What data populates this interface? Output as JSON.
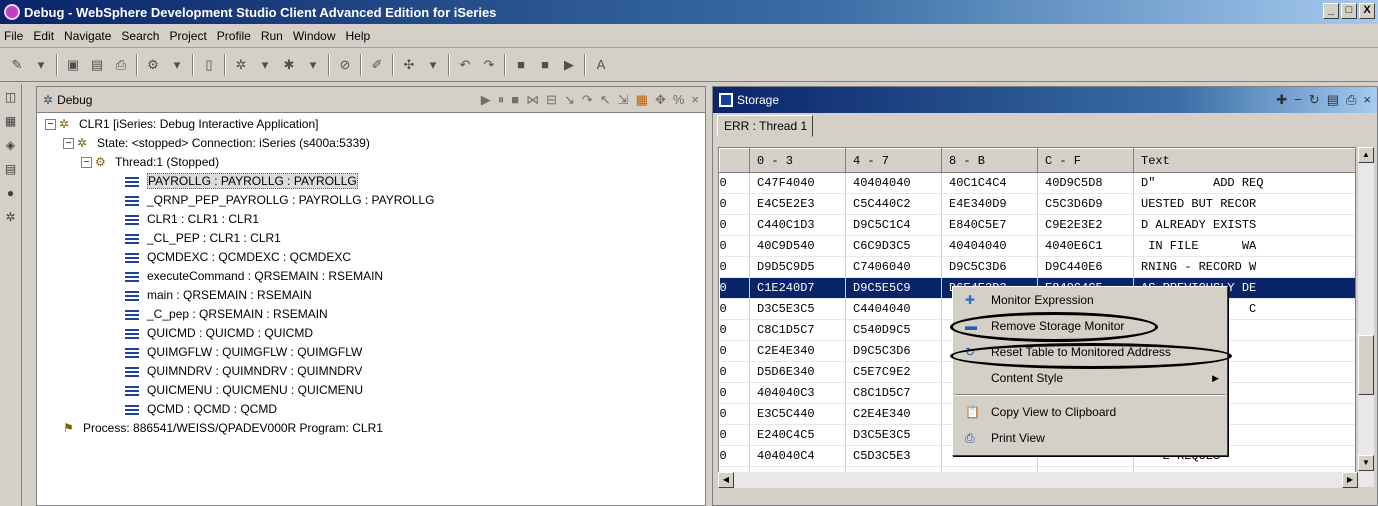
{
  "window": {
    "title": "Debug - WebSphere Development Studio Client Advanced Edition for iSeries",
    "buttons": [
      "_",
      "□",
      "X"
    ]
  },
  "menu": [
    "File",
    "Edit",
    "Navigate",
    "Search",
    "Project",
    "Profile",
    "Run",
    "Window",
    "Help"
  ],
  "debug_view": {
    "title": "Debug",
    "tree": [
      {
        "level": 0,
        "label": "CLR1 [iSeries: Debug Interactive Application]",
        "icon": "debug-target-icon",
        "toggle": "−"
      },
      {
        "level": 1,
        "label": "State: <stopped> Connection: iSeries (s400a:5339)",
        "icon": "state-icon",
        "toggle": "−"
      },
      {
        "level": 2,
        "label": "Thread:1 (Stopped)",
        "icon": "thread-icon",
        "toggle": "−"
      },
      {
        "level": 3,
        "label": "PAYROLLG : PAYROLLG : PAYROLLG",
        "icon": "stack-frame-icon",
        "selected": true
      },
      {
        "level": 3,
        "label": "_QRNP_PEP_PAYROLLG : PAYROLLG : PAYROLLG",
        "icon": "stack-frame-icon"
      },
      {
        "level": 3,
        "label": "CLR1 : CLR1 : CLR1",
        "icon": "stack-frame-icon"
      },
      {
        "level": 3,
        "label": "_CL_PEP : CLR1 : CLR1",
        "icon": "stack-frame-icon"
      },
      {
        "level": 3,
        "label": "QCMDEXC : QCMDEXC : QCMDEXC",
        "icon": "stack-frame-icon"
      },
      {
        "level": 3,
        "label": "executeCommand : QRSEMAIN : RSEMAIN",
        "icon": "stack-frame-icon"
      },
      {
        "level": 3,
        "label": "main : QRSEMAIN : RSEMAIN",
        "icon": "stack-frame-icon"
      },
      {
        "level": 3,
        "label": "_C_pep : QRSEMAIN : RSEMAIN",
        "icon": "stack-frame-icon"
      },
      {
        "level": 3,
        "label": "QUICMD : QUICMD : QUICMD",
        "icon": "stack-frame-icon"
      },
      {
        "level": 3,
        "label": "QUIMGFLW : QUIMGFLW : QUIMGFLW",
        "icon": "stack-frame-icon"
      },
      {
        "level": 3,
        "label": "QUIMNDRV : QUIMNDRV : QUIMNDRV",
        "icon": "stack-frame-icon"
      },
      {
        "level": 3,
        "label": "QUICMENU : QUICMENU : QUICMENU",
        "icon": "stack-frame-icon"
      },
      {
        "level": 3,
        "label": "QCMD : QCMD : QCMD",
        "icon": "stack-frame-icon"
      },
      {
        "level": 1,
        "label": "Process: 886541/WEISS/QPADEV000R  Program: CLR1",
        "icon": "process-icon"
      }
    ]
  },
  "storage_view": {
    "title": "Storage",
    "tab": "ERR : Thread 1",
    "columns": [
      "",
      "0 - 3",
      "4 - 7",
      "8 - B",
      "C - F",
      "Text"
    ],
    "rows": [
      [
        "0",
        "C47F4040",
        "40404040",
        "40C1C4C4",
        "40D9C5D8",
        "D\"        ADD REQ"
      ],
      [
        "0",
        "E4C5E2E3",
        "C5C440C2",
        "E4E340D9",
        "C5C3D6D9",
        "UESTED BUT RECOR"
      ],
      [
        "0",
        "C440C1D3",
        "D9C5C1C4",
        "E840C5E7",
        "C9E2E3E2",
        "D ALREADY EXISTS"
      ],
      [
        "0",
        "40C9D540",
        "C6C9D3C5",
        "40404040",
        "4040E6C1",
        " IN FILE      WA"
      ],
      [
        "0",
        "D9D5C9D5",
        "C7406040",
        "D9C5C3D6",
        "D9C440E6",
        "RNING - RECORD W"
      ],
      [
        "0",
        "C1E240D7",
        "D9C5E5C9",
        "D6E4E2D3",
        "E840C4C5",
        "AS PREVIOUSLY DE"
      ],
      [
        "0",
        "D3C5E3C5",
        "C4404040",
        "",
        "",
        "               C"
      ],
      [
        "0",
        "C8C1D5C7",
        "C540D9C5",
        "",
        "",
        "   QUESTED"
      ],
      [
        "0",
        "C2E4E340",
        "D9C5C3D6",
        "",
        "",
        "   RD DOES"
      ],
      [
        "0",
        "D5D6E340",
        "C5E7C9E2",
        "",
        "",
        "   T"
      ],
      [
        "0",
        "404040C3",
        "C8C1D5C7",
        "",
        "",
        "   E REQUES"
      ],
      [
        "0",
        "E3C5C440",
        "C2E4E340",
        "",
        "",
        "   RECORD I"
      ],
      [
        "0",
        "E240C4C5",
        "D3C5E3C5",
        "",
        "",
        "   D"
      ],
      [
        "0",
        "404040C4",
        "C5D3C5E3",
        "",
        "",
        "   E REQUES"
      ],
      [
        "0",
        "E3C5C440",
        "C2E4E340",
        "D9C5C3D6",
        "D9C440C4",
        "TED BUT RECORD D"
      ]
    ],
    "selected_row": 5
  },
  "context_menu": [
    {
      "label": "Monitor Expression",
      "icon": "plus-icon"
    },
    {
      "label": "Remove Storage Monitor",
      "icon": "minus-icon",
      "circled": true
    },
    {
      "label": "Reset Table to Monitored Address",
      "icon": "reset-icon",
      "circled": true
    },
    {
      "label": "Content Style",
      "icon": "",
      "submenu": true
    },
    {
      "separator": true
    },
    {
      "label": "Copy View to Clipboard",
      "icon": "clipboard-icon"
    },
    {
      "label": "Print View",
      "icon": "printer-icon"
    }
  ]
}
